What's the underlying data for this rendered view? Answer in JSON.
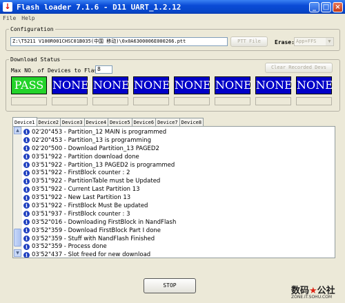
{
  "window": {
    "title": "Flash loader 7.1.6 - D11 UART_1.2.12"
  },
  "menu": [
    "File",
    "Help"
  ],
  "configuration": {
    "legend": "Configuration",
    "path": "Z:\\T5211 V100R001CHSC01B035(中国 移动)\\0x0A6300006E000266.ptt",
    "ptt_file_button": "PTT File",
    "erase_label": "Erase:",
    "erase_value": "App+FFS"
  },
  "download_status": {
    "legend": "Download Status",
    "max_label": "Max NO. of Devices to Flash:",
    "max_value": "8",
    "clear_button": "Clear Recorded Devs",
    "devices": [
      "PASS",
      "NONE",
      "NONE",
      "NONE",
      "NONE",
      "NONE",
      "NONE",
      "NONE"
    ]
  },
  "tabs": [
    "Device1",
    "Device2",
    "Device3",
    "Device4",
    "Device5",
    "Device6",
    "Device7",
    "Device8"
  ],
  "log": [
    "02'20\"453 - Partition_12 MAIN is programmed",
    "02'20\"453 - Partition_13 is programming",
    "02'20\"500 - Download Partition_13 PAGED2",
    "03'51\"922 - Partition download done",
    "03'51\"922 - Partition_13 PAGED2 is programmed",
    "03'51\"922 - FirstBlock counter : 2",
    "03'51\"922 - PartitionTable must be Updated",
    "03'51\"922 - Current Last Partition 13",
    "03'51\"922 - New Last Partition 13",
    "03'51\"922 - FirstBlock Must Be updated",
    "03'51\"937 - FirstBlock counter : 3",
    "03'52\"016 - Downloading FirstBlock in NandFlash",
    "03'52\"359 - Download FirstBlock Part I done",
    "03'52\"359 - Stuff with NandFlash Finished",
    "03'52\"359 - Process done",
    "03'52\"437 - Slot freed for new download"
  ],
  "stop_button": "STOP",
  "watermark": {
    "brand": "数码",
    "star": "★",
    "brand2": "公社",
    "url": "ZONE.IT.SOHU.COM"
  },
  "colors": {
    "pass": "#23d32a",
    "none": "#0000c8",
    "title": "#0a4bd6"
  }
}
